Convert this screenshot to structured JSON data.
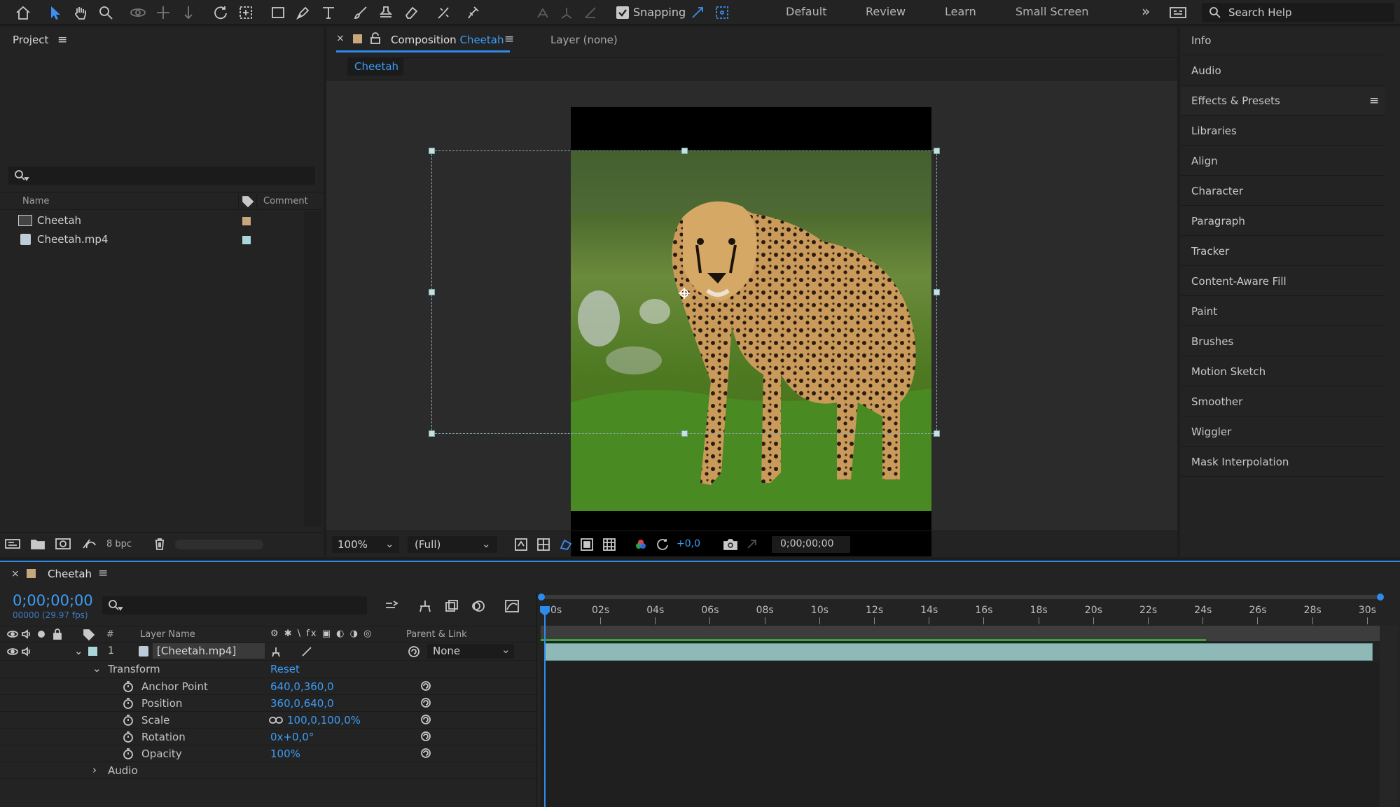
{
  "toolbar": {
    "snapping_label": "Snapping",
    "workspaces": [
      "Default",
      "Review",
      "Learn",
      "Small Screen"
    ],
    "search_placeholder": "Search Help",
    "icons": [
      "home-icon",
      "selection-tool-icon",
      "hand-tool-icon",
      "zoom-tool-icon",
      "orbit-camera-icon",
      "pan-camera-icon",
      "dolly-camera-icon",
      "rotation-tool-icon",
      "pan-behind-icon",
      "rectangle-tool-icon",
      "pen-tool-icon",
      "type-tool-icon",
      "brush-tool-icon",
      "clone-stamp-icon",
      "eraser-icon",
      "roto-brush-icon",
      "puppet-pin-icon"
    ]
  },
  "project": {
    "title": "Project",
    "col_name": "Name",
    "col_comment": "Comment",
    "items": [
      {
        "name": "Cheetah",
        "color": "#c9a77c",
        "icon": "composition-icon"
      },
      {
        "name": "Cheetah.mp4",
        "color": "#a9d6d8",
        "icon": "footage-icon"
      }
    ],
    "bpc": "8 bpc"
  },
  "composition": {
    "tab_prefix": "Composition",
    "tab_name": "Cheetah",
    "layer_tab": "Layer (none)",
    "sub_tab": "Cheetah",
    "zoom": "100%",
    "resolution": "(Full)",
    "exposure": "+0,0",
    "timecode": "0;00;00;00"
  },
  "right_panels": [
    "Info",
    "Audio",
    "Effects & Presets",
    "Libraries",
    "Align",
    "Character",
    "Paragraph",
    "Tracker",
    "Content-Aware Fill",
    "Paint",
    "Brushes",
    "Motion Sketch",
    "Smoother",
    "Wiggler",
    "Mask Interpolation"
  ],
  "timeline": {
    "comp_name": "Cheetah",
    "timecode": "0;00;00;00",
    "frame_info": "00000 (29.97 fps)",
    "col_num": "#",
    "col_layer_name": "Layer Name",
    "col_parent": "Parent & Link",
    "ruler_start": "0s",
    "ticks": [
      "02s",
      "04s",
      "06s",
      "08s",
      "10s",
      "12s",
      "14s",
      "16s",
      "18s",
      "20s",
      "22s",
      "24s",
      "26s",
      "28s",
      "30s"
    ],
    "layer": {
      "num": "1",
      "name": "[Cheetah.mp4]",
      "parent": "None",
      "color": "#a9d6d8"
    },
    "transform_label": "Transform",
    "reset_label": "Reset",
    "properties": [
      {
        "name": "Anchor Point",
        "value": "640,0,360,0"
      },
      {
        "name": "Position",
        "value": "360,0,640,0"
      },
      {
        "name": "Scale",
        "value": "100,0,100,0%"
      },
      {
        "name": "Rotation",
        "value": "0x+0,0°"
      },
      {
        "name": "Opacity",
        "value": "100%"
      }
    ],
    "audio_label": "Audio"
  },
  "colors": {
    "accent": "#2d8ceb",
    "layer_bar": "#8fb9b7",
    "work_area": "#3ba53b"
  }
}
